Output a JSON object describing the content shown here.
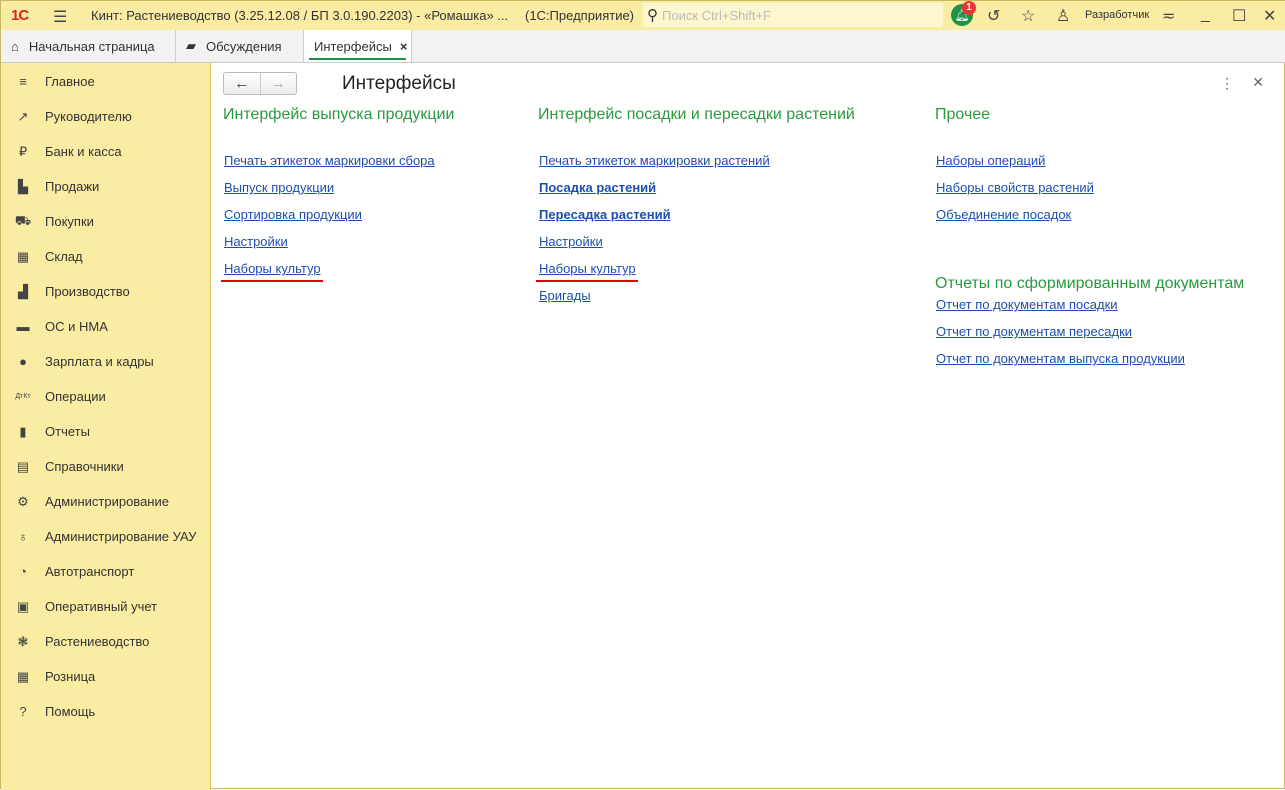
{
  "titlebar": {
    "logo": "1С",
    "title": "Кинт: Растениеводство (3.25.12.08 / БП 3.0.190.2203) - «Ромашка» ...",
    "platform": "(1С:Предприятие)",
    "search_placeholder": "Поиск Ctrl+Shift+F",
    "notifications": "1",
    "user": "Разработчик"
  },
  "tabs": [
    {
      "label": "Начальная страница",
      "icon": "home-icon"
    },
    {
      "label": "Обсуждения",
      "icon": "chat-icon"
    },
    {
      "label": "Интерфейсы",
      "close": "×"
    }
  ],
  "sidebar": {
    "items": [
      {
        "label": "Главное",
        "icon": "menu-icon",
        "glyph": "≡"
      },
      {
        "label": "Руководителю",
        "icon": "trend-icon",
        "glyph": "↗"
      },
      {
        "label": "Банк и касса",
        "icon": "ruble-icon",
        "glyph": "₽"
      },
      {
        "label": "Продажи",
        "icon": "bag-icon",
        "glyph": "▙"
      },
      {
        "label": "Покупки",
        "icon": "cart-icon",
        "glyph": "⛟"
      },
      {
        "label": "Склад",
        "icon": "warehouse-icon",
        "glyph": "▦"
      },
      {
        "label": "Производство",
        "icon": "factory-icon",
        "glyph": "▟"
      },
      {
        "label": "ОС и НМА",
        "icon": "truck-icon",
        "glyph": "▬"
      },
      {
        "label": "Зарплата и кадры",
        "icon": "person-icon",
        "glyph": "●"
      },
      {
        "label": "Операции",
        "icon": "dt-kt-icon",
        "glyph": "ДтКт"
      },
      {
        "label": "Отчеты",
        "icon": "bar-chart-icon",
        "glyph": "▮"
      },
      {
        "label": "Справочники",
        "icon": "books-icon",
        "glyph": "▤"
      },
      {
        "label": "Администрирование",
        "icon": "gear-icon",
        "glyph": "⚙"
      },
      {
        "label": "Администрирование УАУ",
        "icon": "bulb-icon",
        "glyph": "♁"
      },
      {
        "label": "Автотранспорт",
        "icon": "speedometer-icon",
        "glyph": "◔"
      },
      {
        "label": "Оперативный учет",
        "icon": "presentation-icon",
        "glyph": "▣"
      },
      {
        "label": "Растениеводство",
        "icon": "flower-icon",
        "glyph": "❃"
      },
      {
        "label": "Розница",
        "icon": "calculator-icon",
        "glyph": "▦"
      },
      {
        "label": "Помощь",
        "icon": "help-icon",
        "glyph": "?"
      }
    ]
  },
  "main": {
    "title": "Интерфейсы",
    "groups": [
      {
        "title": "Интерфейс выпуска продукции",
        "links": [
          {
            "label": "Печать этикеток маркировки сбора"
          },
          {
            "label": "Выпуск продукции"
          },
          {
            "label": "Сортировка продукции"
          },
          {
            "label": "Настройки"
          },
          {
            "label": "Наборы культур",
            "highlighted": true
          }
        ]
      },
      {
        "title": "Интерфейс посадки и пересадки растений",
        "links": [
          {
            "label": "Печать этикеток маркировки растений"
          },
          {
            "label": "Посадка растений",
            "bold": true
          },
          {
            "label": "Пересадка растений",
            "bold": true
          },
          {
            "label": "Настройки"
          },
          {
            "label": "Наборы культур",
            "highlighted": true
          },
          {
            "label": "Бригады"
          }
        ]
      },
      {
        "title": "Прочее",
        "links": [
          {
            "label": "Наборы операций"
          },
          {
            "label": "Наборы свойств растений"
          },
          {
            "label": "Объединение посадок"
          }
        ]
      },
      {
        "title": "Отчеты по сформированным документам",
        "links": [
          {
            "label": "Отчет по документам посадки"
          },
          {
            "label": "Отчет по документам пересадки"
          },
          {
            "label": "Отчет по документам выпуска продукции"
          }
        ]
      }
    ]
  },
  "colors": {
    "accent": "#2a9a3e",
    "link": "#1d4fb0",
    "highlight": "#e00000",
    "panel": "#fbeca3"
  }
}
